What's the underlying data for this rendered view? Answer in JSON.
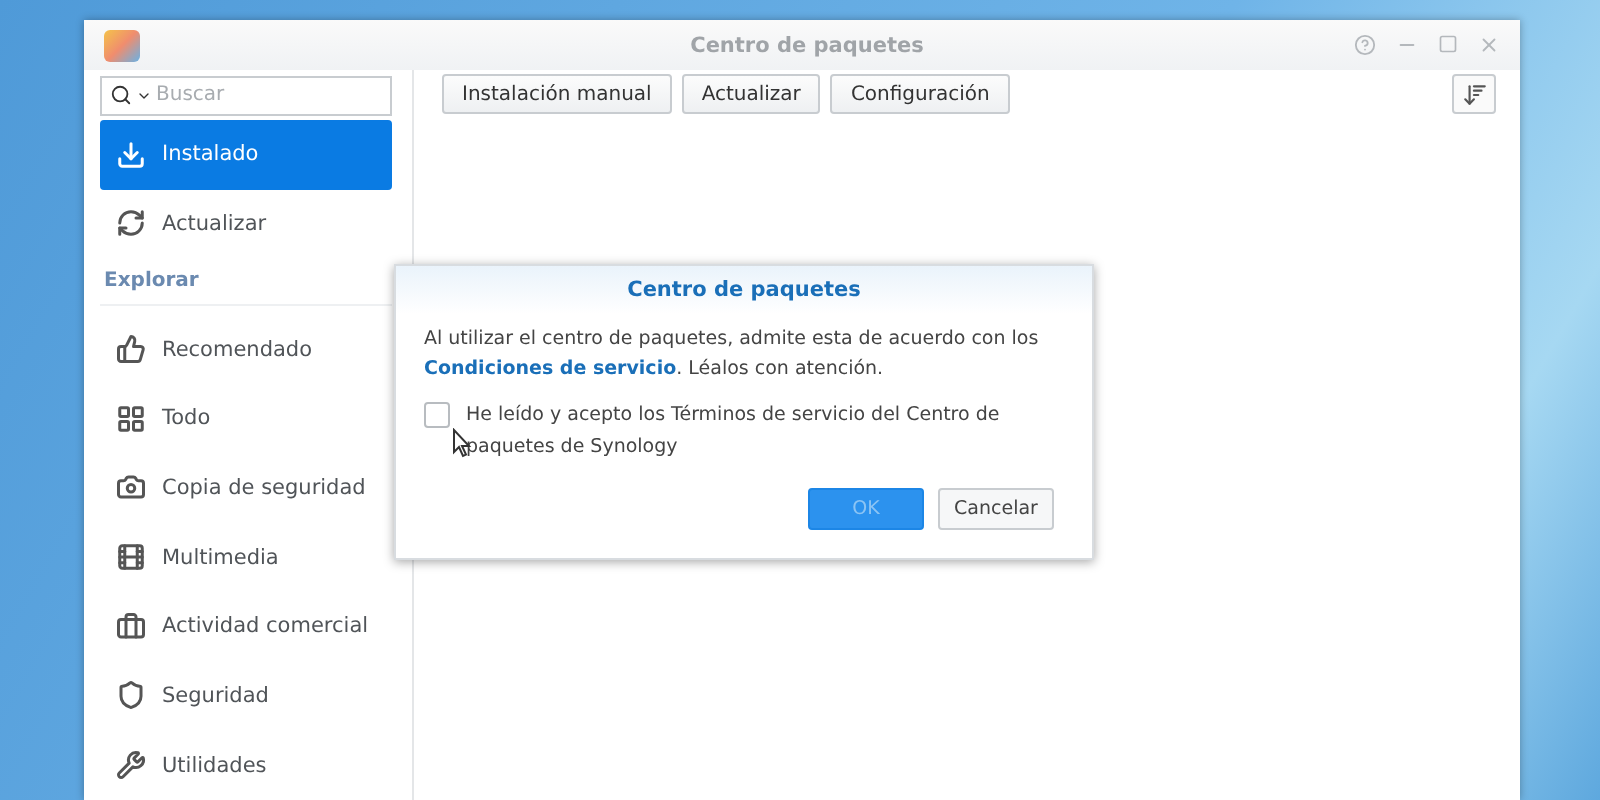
{
  "window": {
    "title": "Centro de paquetes"
  },
  "sidebar": {
    "search": {
      "placeholder": "Buscar"
    },
    "items": [
      {
        "kind": "item",
        "label": "Instalado",
        "selected": true
      },
      {
        "kind": "item",
        "label": "Actualizar",
        "selected": false
      },
      {
        "kind": "heading",
        "label": "Explorar"
      },
      {
        "kind": "item",
        "label": "Recomendado",
        "selected": false
      },
      {
        "kind": "item",
        "label": "Todo",
        "selected": false
      },
      {
        "kind": "item",
        "label": "Copia de seguridad",
        "selected": false
      },
      {
        "kind": "item",
        "label": "Multimedia",
        "selected": false
      },
      {
        "kind": "item",
        "label": "Actividad comercial",
        "selected": false
      },
      {
        "kind": "item",
        "label": "Seguridad",
        "selected": false
      },
      {
        "kind": "item",
        "label": "Utilidades",
        "selected": false
      }
    ]
  },
  "toolbar": {
    "buttons": [
      "Instalación manual",
      "Actualizar",
      "Configuración"
    ]
  },
  "dialog": {
    "title": "Centro de paquetes",
    "text_before": "Al utilizar el centro de paquetes, admite esta de acuerdo con los",
    "link": "Condiciones de servicio",
    "text_after": ". Léalos con atención.",
    "checkbox": {
      "label": "He leído y acepto los Términos de servicio del Centro de paquetes de Synology",
      "checked": false
    },
    "buttons": [
      {
        "kind": "primary",
        "label": "OK",
        "disabled": true
      },
      {
        "kind": "default",
        "label": "Cancelar",
        "disabled": false
      }
    ]
  }
}
